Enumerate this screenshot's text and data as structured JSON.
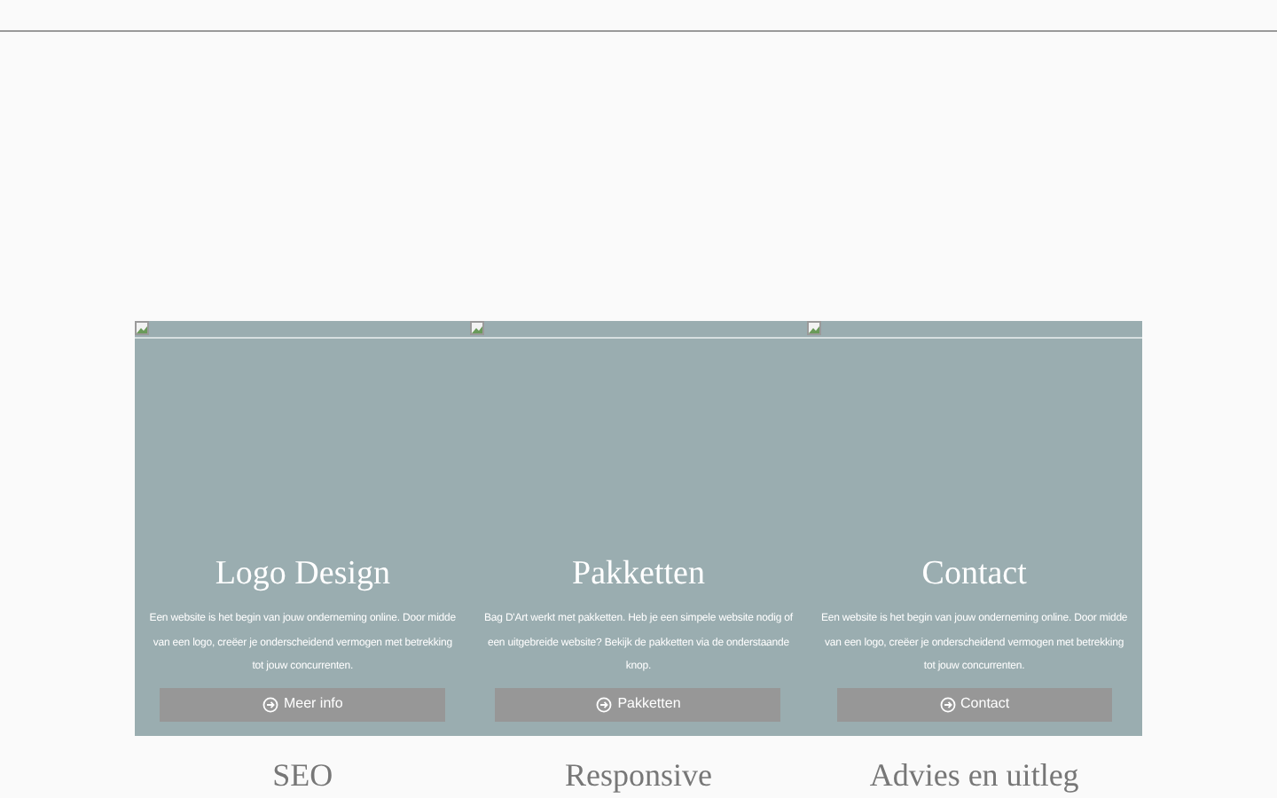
{
  "cards": [
    {
      "title": "Logo Design",
      "text": "Een website is het begin van jouw onderneming online. Door midde\nvan een logo, creëer je onderscheidend vermogen met betrekking\ntot jouw concurrenten.",
      "button": "Meer info"
    },
    {
      "title": "Pakketten",
      "text": "Bag D'Art werkt met pakketten. Heb je een simpele website nodig of\neen uitgebreide website? Bekijk de pakketten via de onderstaande\nknop.",
      "button": "Pakketten"
    },
    {
      "title": "Contact",
      "text": "Een website is het begin van jouw onderneming online. Door midde\nvan een logo, creëer je onderscheidend vermogen met betrekking\ntot jouw concurrenten.",
      "button": "Contact"
    }
  ],
  "features": [
    {
      "title": "SEO"
    },
    {
      "title": "Responsive"
    },
    {
      "title": "Advies en uitleg"
    }
  ]
}
